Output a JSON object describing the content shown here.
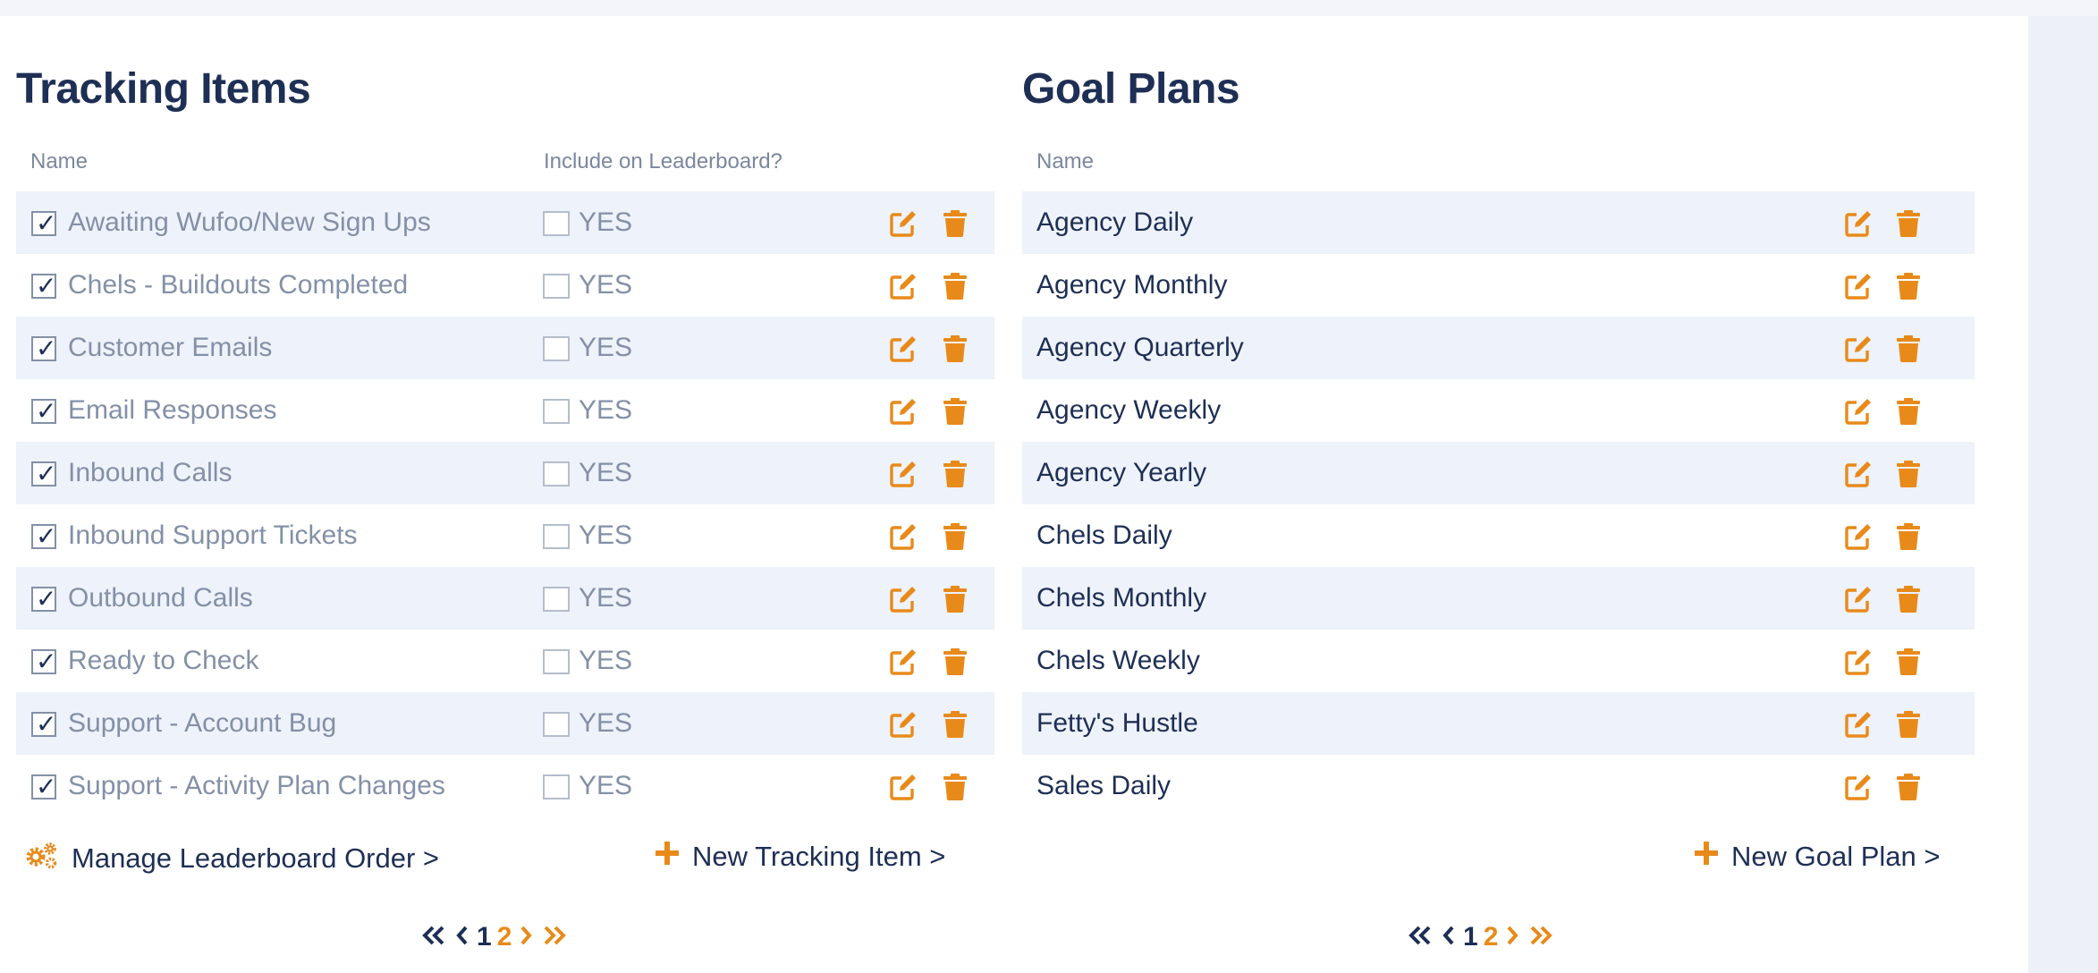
{
  "tracking": {
    "title": "Tracking Items",
    "col_name": "Name",
    "col_leaderboard": "Include on Leaderboard?",
    "yes_label": "YES",
    "items": [
      {
        "name": "Awaiting Wufoo/New Sign Ups",
        "active": true,
        "leaderboard": false
      },
      {
        "name": "Chels - Buildouts Completed",
        "active": true,
        "leaderboard": false
      },
      {
        "name": "Customer Emails",
        "active": true,
        "leaderboard": false
      },
      {
        "name": "Email Responses",
        "active": true,
        "leaderboard": false
      },
      {
        "name": "Inbound Calls",
        "active": true,
        "leaderboard": false
      },
      {
        "name": "Inbound Support Tickets",
        "active": true,
        "leaderboard": false
      },
      {
        "name": "Outbound Calls",
        "active": true,
        "leaderboard": false
      },
      {
        "name": "Ready to Check",
        "active": true,
        "leaderboard": false
      },
      {
        "name": "Support - Account Bug",
        "active": true,
        "leaderboard": false
      },
      {
        "name": "Support - Activity Plan Changes",
        "active": true,
        "leaderboard": false
      }
    ],
    "manage_link": "Manage Leaderboard Order >",
    "new_link": "New Tracking Item >",
    "pagination": {
      "pages": [
        "1",
        "2"
      ],
      "current": "1"
    }
  },
  "goals": {
    "title": "Goal Plans",
    "col_name": "Name",
    "items": [
      {
        "name": "Agency Daily"
      },
      {
        "name": "Agency Monthly"
      },
      {
        "name": "Agency Quarterly"
      },
      {
        "name": "Agency Weekly"
      },
      {
        "name": "Agency Yearly"
      },
      {
        "name": "Chels Daily"
      },
      {
        "name": "Chels Monthly"
      },
      {
        "name": "Chels Weekly"
      },
      {
        "name": "Fetty's Hustle"
      },
      {
        "name": "Sales Daily"
      }
    ],
    "new_link": "New Goal Plan >",
    "pagination": {
      "pages": [
        "1",
        "2"
      ],
      "current": "1"
    }
  },
  "icons": {
    "edit": "edit-icon",
    "delete": "trash-icon",
    "gears": "gears-icon",
    "plus": "plus-icon",
    "first": "double-chevron-left-icon",
    "prev": "chevron-left-icon",
    "next": "chevron-right-icon",
    "last": "double-chevron-right-icon"
  },
  "colors": {
    "accent": "#e88a1a",
    "navy": "#1e2f55",
    "muted": "#8390a7",
    "row_shade": "#eef2fa",
    "background": "#f3f5fb"
  }
}
